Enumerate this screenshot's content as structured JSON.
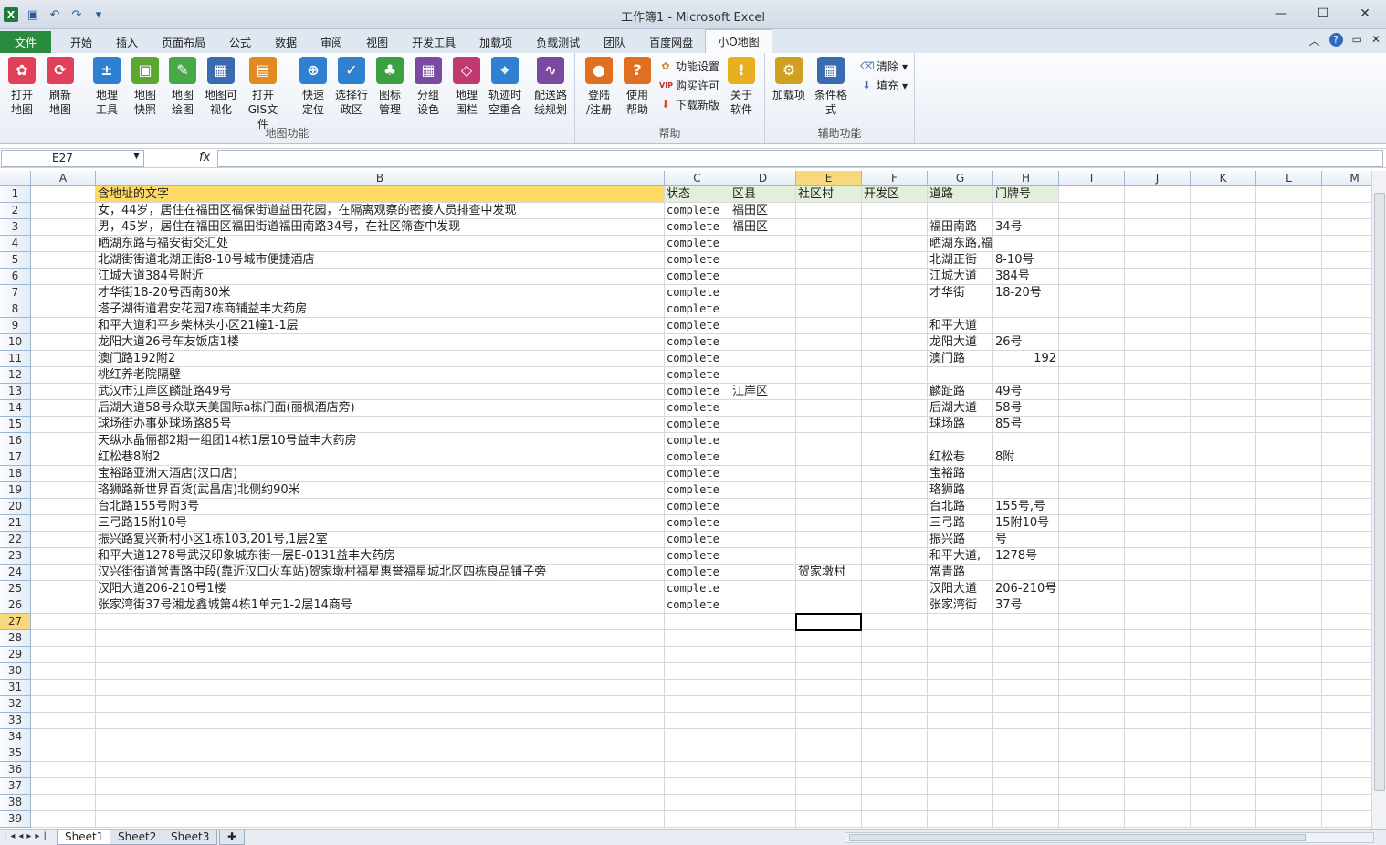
{
  "window": {
    "title": "工作簿1 - Microsoft Excel"
  },
  "qat": [
    "excel-logo-icon",
    "save-icon",
    "undo-icon",
    "redo-icon",
    "customize-icon"
  ],
  "tabs": [
    "文件",
    "开始",
    "插入",
    "页面布局",
    "公式",
    "数据",
    "审阅",
    "视图",
    "开发工具",
    "加载项",
    "负载测试",
    "团队",
    "百度网盘",
    "小O地图"
  ],
  "active_tab": "小O地图",
  "ribbon": {
    "groups": [
      {
        "label": "地图功能",
        "buttons": [
          "打开\n地图",
          "刷新\n地图",
          "地理\n工具",
          "地图\n快照",
          "地图\n绘图",
          "地图可\n视化",
          "打开\nGIS文件",
          "快速\n定位",
          "选择行\n政区",
          "图标\n管理",
          "分组\n设色",
          "地理\n围栏",
          "轨迹时\n空重合",
          "配送路\n线规划"
        ]
      },
      {
        "label": "帮助",
        "buttons": [
          "登陆\n/注册",
          "使用\n帮助",
          "关于\n软件"
        ],
        "small": [
          "功能设置",
          "购买许可",
          "下载新版"
        ]
      },
      {
        "label": "辅助功能",
        "buttons": [
          "加载项",
          "条件格式"
        ],
        "small": [
          "清除",
          "填充"
        ]
      }
    ]
  },
  "namebox": "E27",
  "fx": "fx",
  "columns": [
    "A",
    "B",
    "C",
    "D",
    "E",
    "F",
    "G",
    "H",
    "I",
    "J",
    "K",
    "L",
    "M"
  ],
  "selected_cell": {
    "col": "E",
    "row": 27
  },
  "rows": [
    [
      "",
      "含地址的文字",
      "状态",
      "区县",
      "社区村",
      "开发区",
      "道路",
      "门牌号"
    ],
    [
      "",
      "女，44岁，居住在福田区福保街道益田花园，在隔离观察的密接人员排查中发现",
      "complete",
      "福田区",
      "",
      "",
      "",
      ""
    ],
    [
      "",
      "男，45岁，居住在福田区福田街道福田南路34号，在社区筛查中发现",
      "complete",
      "福田区",
      "",
      "",
      "福田南路",
      "34号"
    ],
    [
      "",
      "晒湖东路与福安街交汇处",
      "complete",
      "",
      "",
      "",
      "晒湖东路,福安街",
      ""
    ],
    [
      "",
      "北湖街街道北湖正街8-10号城市便捷酒店",
      "complete",
      "",
      "",
      "",
      "北湖正街",
      "8-10号"
    ],
    [
      "",
      "江城大道384号附近",
      "complete",
      "",
      "",
      "",
      "江城大道",
      "384号"
    ],
    [
      "",
      "才华街18-20号西南80米",
      "complete",
      "",
      "",
      "",
      "才华街",
      "18-20号"
    ],
    [
      "",
      "塔子湖街道君安花园7栋商铺益丰大药房",
      "complete",
      "",
      "",
      "",
      "",
      ""
    ],
    [
      "",
      "和平大道和平乡柴林头小区21幢1-1层",
      "complete",
      "",
      "",
      "",
      "和平大道",
      ""
    ],
    [
      "",
      "龙阳大道26号车友饭店1楼",
      "complete",
      "",
      "",
      "",
      "龙阳大道",
      "26号"
    ],
    [
      "",
      "澳门路192附2",
      "complete",
      "",
      "",
      "",
      "澳门路",
      "192"
    ],
    [
      "",
      "桃红养老院隔壁",
      "complete",
      "",
      "",
      "",
      "",
      ""
    ],
    [
      "",
      "武汉市江岸区麟趾路49号",
      "complete",
      "江岸区",
      "",
      "",
      "麟趾路",
      "49号"
    ],
    [
      "",
      "后湖大道58号众联天美国际a栋门面(丽枫酒店旁)",
      "complete",
      "",
      "",
      "",
      "后湖大道",
      "58号"
    ],
    [
      "",
      "球场街办事处球场路85号",
      "complete",
      "",
      "",
      "",
      "球场路",
      "85号"
    ],
    [
      "",
      "天纵水晶俪都2期一组团14栋1层10号益丰大药房",
      "complete",
      "",
      "",
      "",
      "",
      ""
    ],
    [
      "",
      "红松巷8附2",
      "complete",
      "",
      "",
      "",
      "红松巷",
      "8附"
    ],
    [
      "",
      "宝裕路亚洲大酒店(汉口店)",
      "complete",
      "",
      "",
      "",
      "宝裕路",
      ""
    ],
    [
      "",
      "珞狮路新世界百货(武昌店)北侧约90米",
      "complete",
      "",
      "",
      "",
      "珞狮路",
      ""
    ],
    [
      "",
      "台北路155号附3号",
      "complete",
      "",
      "",
      "",
      "台北路",
      "155号,号"
    ],
    [
      "",
      "三弓路15附10号",
      "complete",
      "",
      "",
      "",
      "三弓路",
      "15附10号"
    ],
    [
      "",
      "振兴路复兴新村小区1栋103,201号,1层2室",
      "complete",
      "",
      "",
      "",
      "振兴路",
      "号"
    ],
    [
      "",
      "和平大道1278号武汉印象城东街一层E-0131益丰大药房",
      "complete",
      "",
      "",
      "",
      "和平大道,",
      "1278号"
    ],
    [
      "",
      "汉兴街街道常青路中段(靠近汉口火车站)贺家墩村福星惠誉福星城北区四栋良品铺子旁",
      "complete",
      "",
      "贺家墩村",
      "",
      "常青路",
      ""
    ],
    [
      "",
      "汉阳大道206-210号1楼",
      "complete",
      "",
      "",
      "",
      "汉阳大道",
      "206-210号"
    ],
    [
      "",
      "张家湾街37号湘龙鑫城第4栋1单元1-2层14商号",
      "complete",
      "",
      "",
      "",
      "张家湾街",
      "37号"
    ]
  ],
  "total_rows": 39,
  "sheets": [
    "Sheet1",
    "Sheet2",
    "Sheet3"
  ],
  "active_sheet": "Sheet1",
  "colors": {
    "header_yellow": "#ffd966",
    "header_green": "#e2efda",
    "file_tab": "#2a8a3e"
  }
}
